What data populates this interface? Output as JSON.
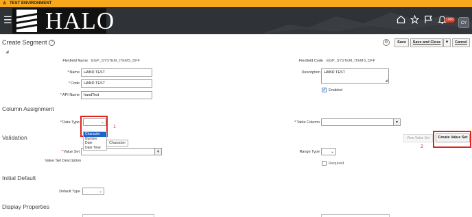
{
  "banner": {
    "text": "TEST ENVIRONMENT"
  },
  "header": {
    "logo_text": "HALO",
    "notification_count": "1966",
    "user_initials": "CY",
    "icons": [
      "menu-icon",
      "home-icon",
      "star-icon",
      "flag-icon",
      "bell-icon"
    ]
  },
  "page": {
    "title": "Create Segment",
    "buttons": {
      "save": "Save",
      "save_close": "Save and Close",
      "cancel": "Cancel"
    }
  },
  "form": {
    "flexfield_name_label": "Flexfield Name",
    "flexfield_name_value": "EGP_SYSTEM_ITEMS_DFF",
    "flexfield_code_label": "Flexfield Code",
    "flexfield_code_value": "EGP_SYSTEM_ITEMS_DFF",
    "name_label": "Name",
    "name_value": "HAND TEST",
    "code_label": "Code",
    "code_value": "HAND TEST",
    "api_name_label": "API Name",
    "api_name_value": "handTest",
    "description_label": "Description",
    "description_value": "HAND TEST",
    "enabled_label": "Enabled",
    "enabled": true
  },
  "column_assignment": {
    "title": "Column Assignment",
    "data_type_label": "Data Type",
    "data_type_options": [
      "Character",
      "Number",
      "Date",
      "Date Time"
    ],
    "selected_option": "Character",
    "tooltip": "Character",
    "table_column_label": "Table Column"
  },
  "validation": {
    "title": "Validation",
    "value_set_label": "Value Set",
    "value_set_description_label": "Value Set Description",
    "range_type_label": "Range Type",
    "required_label": "Required",
    "view_value_set": "View Value Set",
    "create_value_set": "Create Value Set"
  },
  "initial_default": {
    "title": "Initial Default",
    "default_type_label": "Default Type"
  },
  "display_properties": {
    "title": "Display Properties"
  },
  "annotations": {
    "marker_1": "1",
    "marker_2": "2"
  },
  "colors": {
    "banner": "#f7a81b",
    "topbar": "#2f3236",
    "highlight": "#e0231c",
    "selected": "#1f62c8",
    "required": "#cc0000"
  }
}
